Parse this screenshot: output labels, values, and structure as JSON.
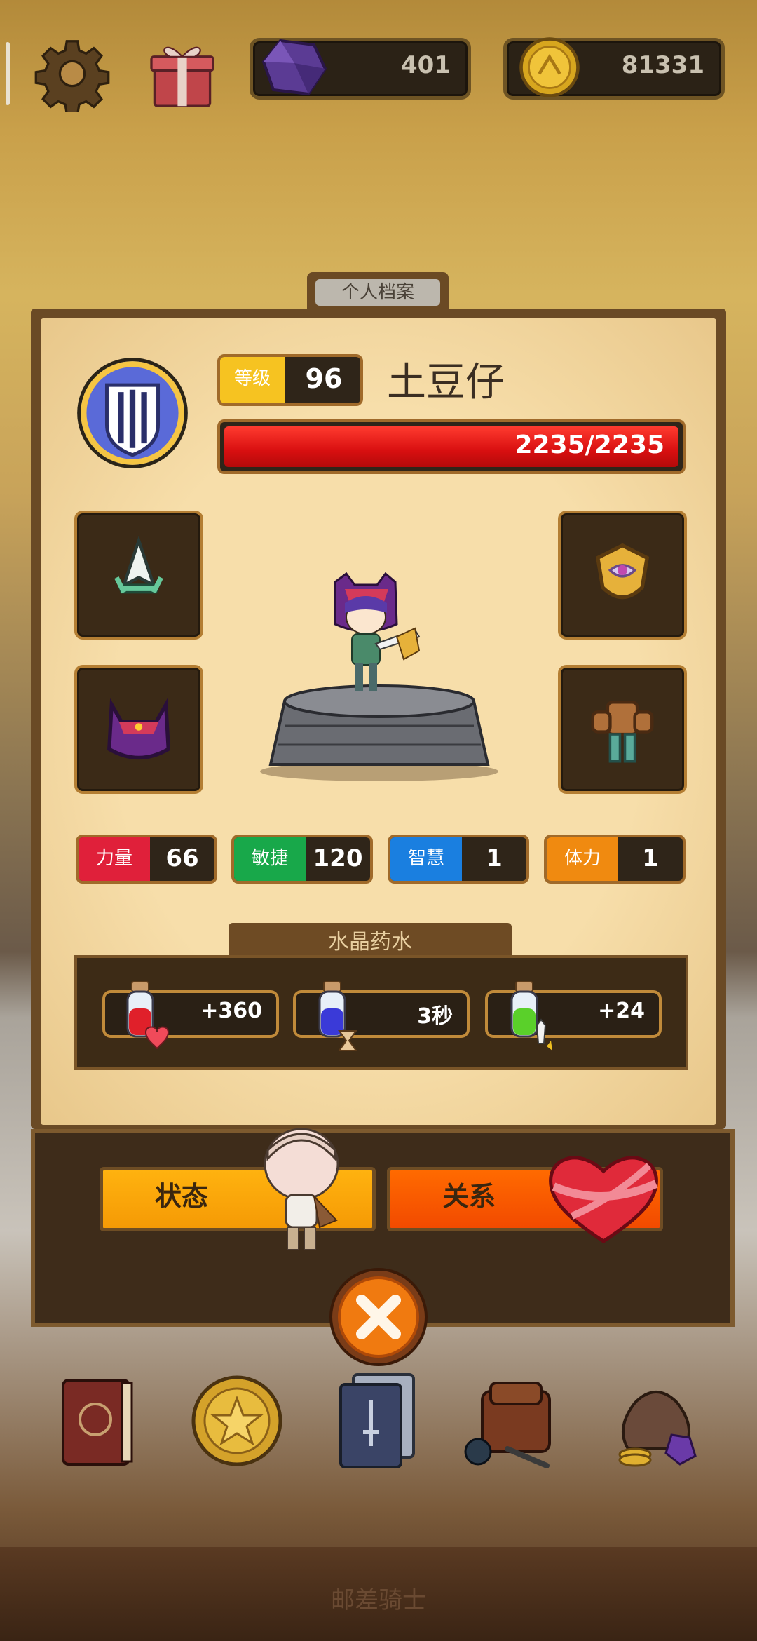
{
  "topbar": {
    "gems": "401",
    "coins": "81331",
    "icons": [
      "gear-icon",
      "gift-icon",
      "gem-icon",
      "coin-icon"
    ]
  },
  "profile": {
    "tab_label": "个人档案",
    "level_label": "等级",
    "level": "96",
    "name": "土豆仔",
    "hp_text": "2235/2235",
    "hp_fraction": 1.0
  },
  "equipment": {
    "slots": [
      "weapon-slot",
      "helmet-slot",
      "shield-slot",
      "armor-slot"
    ]
  },
  "stats": {
    "strength": {
      "label": "力量",
      "value": "66",
      "color": "#e0203a"
    },
    "agility": {
      "label": "敏捷",
      "value": "120",
      "color": "#18a84a"
    },
    "wisdom": {
      "label": "智慧",
      "value": "1",
      "color": "#1a7fe0"
    },
    "vitality": {
      "label": "体力",
      "value": "1",
      "color": "#f08a10"
    }
  },
  "potions": {
    "title": "水晶药水",
    "hp": "+360",
    "time": "3秒",
    "attack": "+24"
  },
  "actions": {
    "status": "状态",
    "relation": "关系"
  },
  "footer": {
    "title": "邮差骑士"
  }
}
